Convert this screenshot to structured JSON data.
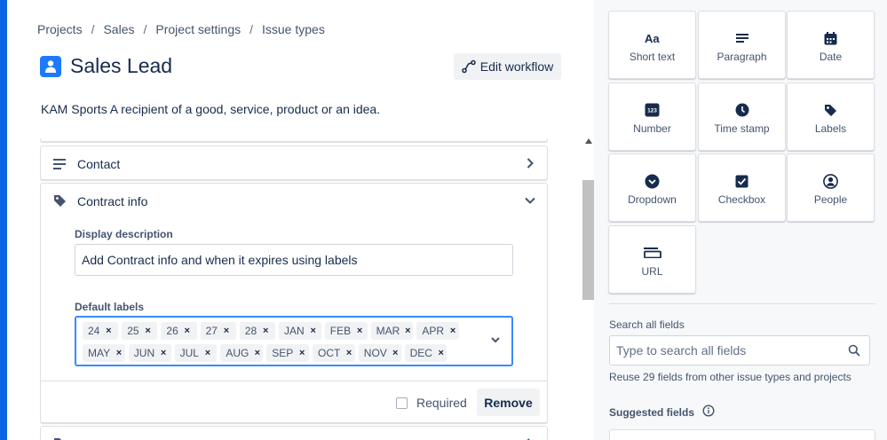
{
  "breadcrumb": [
    "Projects",
    "Sales",
    "Project settings",
    "Issue types"
  ],
  "breadcrumb_separator": "/",
  "page": {
    "title": "Sales Lead",
    "description": "KAM Sports A recipient of a good, service, product or an idea.",
    "edit_workflow_label": "Edit workflow",
    "accent_color": "#1d7afc"
  },
  "fields": {
    "contact": {
      "label": "Contact",
      "icon": "paragraph-icon"
    },
    "contract": {
      "label": "Contract info",
      "icon": "tag-icon",
      "display_description_label": "Display description",
      "display_description_value": "Add Contract info and when it expires using labels",
      "default_labels_label": "Default labels",
      "tags_row1": [
        "24",
        "25",
        "26",
        "27",
        "28",
        "JAN",
        "FEB",
        "MAR",
        "APR"
      ],
      "tags_row2": [
        "MAY",
        "JUN",
        "JUL",
        "AUG",
        "SEP",
        "OCT",
        "NOV",
        "DEC"
      ],
      "tag_remove_symbol": "×",
      "required_label": "Required",
      "required_checked": false,
      "remove_label": "Remove"
    }
  },
  "field_types": [
    {
      "label": "Short text",
      "icon": "text-aa-icon"
    },
    {
      "label": "Paragraph",
      "icon": "paragraph-icon"
    },
    {
      "label": "Date",
      "icon": "calendar-icon"
    },
    {
      "label": "Number",
      "icon": "number-icon"
    },
    {
      "label": "Time stamp",
      "icon": "clock-icon"
    },
    {
      "label": "Labels",
      "icon": "tag-icon"
    },
    {
      "label": "Dropdown",
      "icon": "dropdown-icon"
    },
    {
      "label": "Checkbox",
      "icon": "checkbox-icon"
    },
    {
      "label": "People",
      "icon": "person-icon"
    },
    {
      "label": "URL",
      "icon": "url-icon"
    }
  ],
  "sidebar": {
    "search_label": "Search all fields",
    "search_placeholder": "Type to search all fields",
    "reuse_text": "Reuse 29 fields from other issue types and projects",
    "suggested_label": "Suggested fields"
  }
}
